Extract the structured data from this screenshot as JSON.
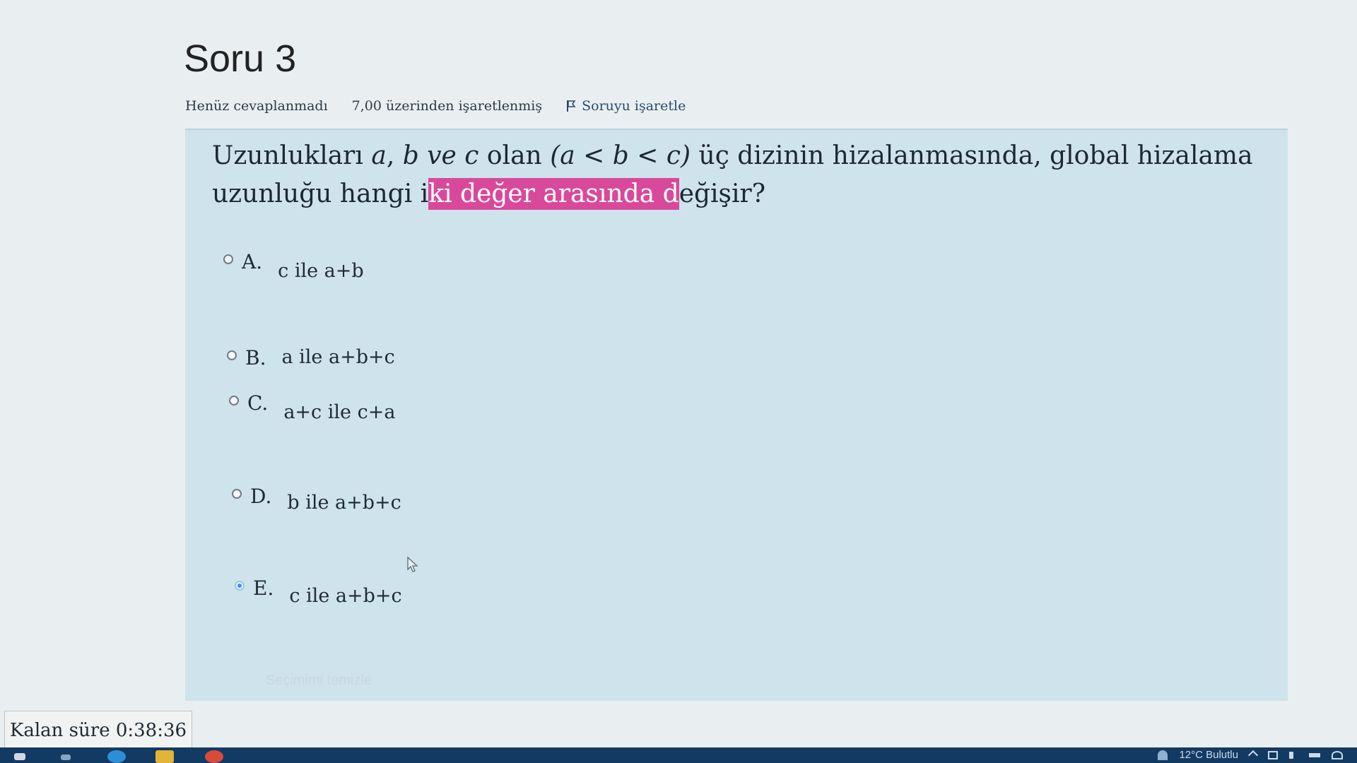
{
  "question": {
    "title": "Soru 3",
    "status": "Henüz cevaplanmadı",
    "marks": "7,00 üzerinden işaretlenmiş",
    "flag_label": "Soruyu işaretle",
    "text_part1": "Uzunlukları ",
    "var_a": "a",
    "comma": ", ",
    "var_b": "b",
    "ve_c": " ve c",
    "olan": " olan ",
    "condition": "(a < b < c)",
    "text_part2": " üç dizinin hizalanmasında, global hizalama uzunluğu hangi i",
    "highlighted": "ki değer arasında d",
    "text_part3": "eğişir?"
  },
  "answers": [
    {
      "letter": "A.",
      "text": "c ile a+b",
      "selected": false
    },
    {
      "letter": "B.",
      "text": "a ile a+b+c",
      "selected": false
    },
    {
      "letter": "C.",
      "text": "a+c ile c+a",
      "selected": false
    },
    {
      "letter": "D.",
      "text": "b ile a+b+c",
      "selected": false
    },
    {
      "letter": "E.",
      "text": "c ile a+b+c",
      "selected": true
    }
  ],
  "clear_choice": "Seçimimi temizle",
  "timer": "Kalan süre 0:38:36",
  "tray": {
    "weather": "12°C Bulutlu"
  },
  "colors": {
    "highlight": "#d9499b",
    "card": "#cfe3ec",
    "taskbar": "#123a63"
  }
}
